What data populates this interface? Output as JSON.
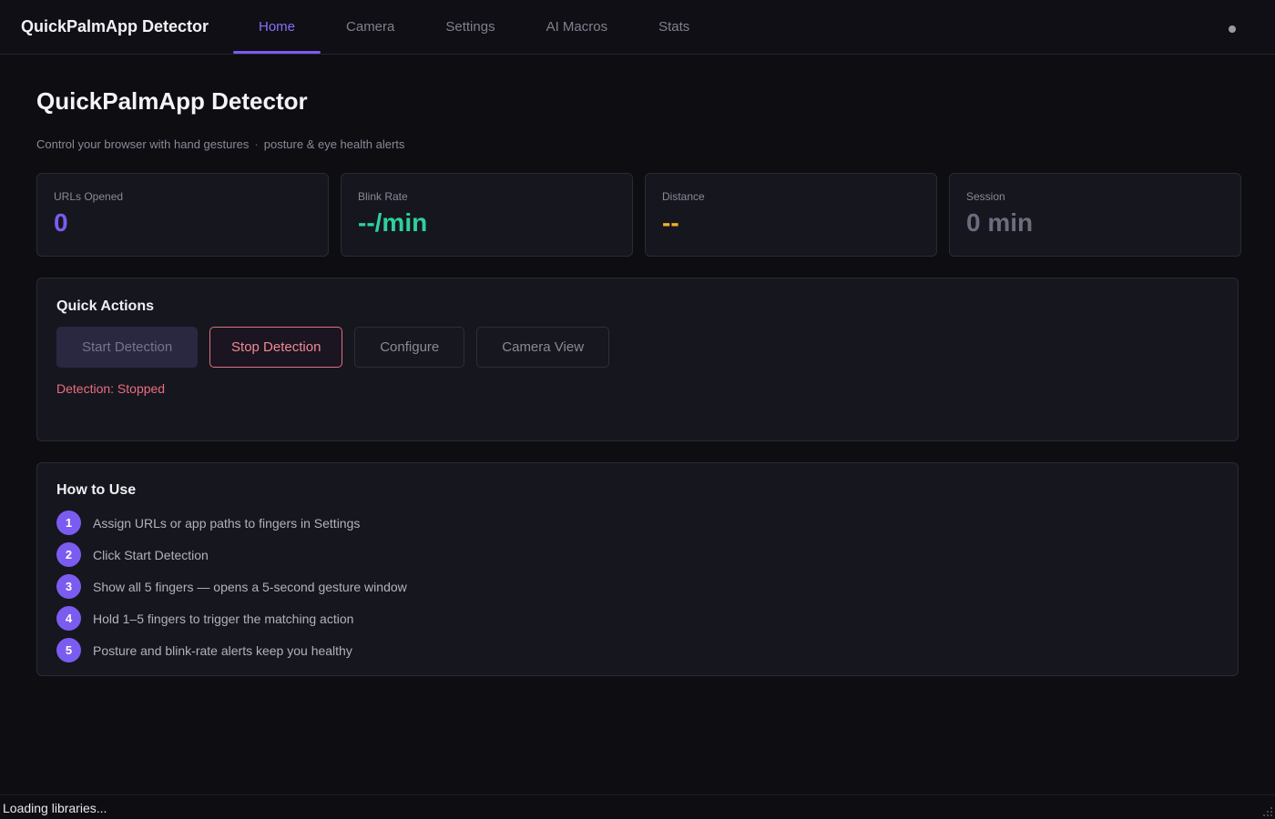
{
  "app": {
    "brand": "QuickPalmApp Detector"
  },
  "nav": {
    "tabs": [
      {
        "label": "Home",
        "active": true
      },
      {
        "label": "Camera",
        "active": false
      },
      {
        "label": "Settings",
        "active": false
      },
      {
        "label": "AI Macros",
        "active": false
      },
      {
        "label": "Stats",
        "active": false
      }
    ]
  },
  "page": {
    "title": "QuickPalmApp Detector",
    "subtitle_part1": "Control your browser with hand gestures",
    "subtitle_separator": "·",
    "subtitle_part2": "posture & eye health alerts"
  },
  "stats": [
    {
      "label": "URLs Opened",
      "value": "0",
      "color": "#7b5cf0"
    },
    {
      "label": "Blink Rate",
      "value": "--/min",
      "color": "#2ed19c"
    },
    {
      "label": "Distance",
      "value": "--",
      "color": "#f2b02e"
    },
    {
      "label": "Session",
      "value": "0 min",
      "color": "#6c6c7c"
    }
  ],
  "quick_actions": {
    "title": "Quick Actions",
    "start_label": "Start Detection",
    "stop_label": "Stop Detection",
    "configure_label": "Configure",
    "camera_label": "Camera View",
    "detection_status": "Detection: Stopped"
  },
  "how_to": {
    "title": "How to Use",
    "steps": [
      {
        "num": "1",
        "text": "Assign URLs or app paths to fingers in Settings"
      },
      {
        "num": "2",
        "text": "Click Start Detection"
      },
      {
        "num": "3",
        "text": "Show all 5 fingers — opens a 5-second gesture window"
      },
      {
        "num": "4",
        "text": "Hold 1–5 fingers to trigger the matching action"
      },
      {
        "num": "5",
        "text": "Posture and blink-rate alerts keep you healthy"
      }
    ]
  },
  "statusbar": {
    "text": "Loading libraries..."
  },
  "colors": {
    "accent": "#7b5cf0",
    "danger": "#ec6e7c"
  },
  "icons": {
    "status_dot": "status-dot-icon",
    "resize_grip": "resize-grip-icon"
  }
}
